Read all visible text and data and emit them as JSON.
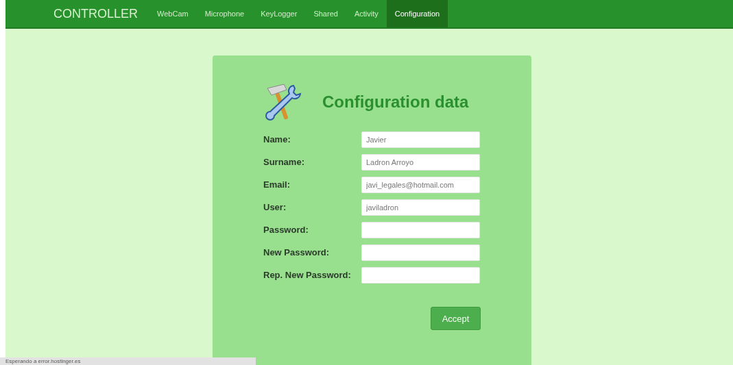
{
  "navbar": {
    "brand": "CONTROLLER",
    "items": [
      {
        "label": "WebCam",
        "selected": false
      },
      {
        "label": "Microphone",
        "selected": false
      },
      {
        "label": "KeyLogger",
        "selected": false
      },
      {
        "label": "Shared",
        "selected": false
      },
      {
        "label": "Activity",
        "selected": false
      },
      {
        "label": "Configuration",
        "selected": true
      }
    ]
  },
  "form": {
    "title": "Configuration data",
    "fields": [
      {
        "label": "Name:",
        "value": "Javier"
      },
      {
        "label": "Surname:",
        "value": "Ladron Arroyo"
      },
      {
        "label": "Email:",
        "value": "javi_legales@hotmail.com"
      },
      {
        "label": "User:",
        "value": "javiladron"
      },
      {
        "label": "Password:"
      },
      {
        "label": "New Password:"
      },
      {
        "label": "Rep. New Password:"
      }
    ],
    "button": "Accept"
  },
  "status_bar": "Esperando a error.hostinger.es"
}
